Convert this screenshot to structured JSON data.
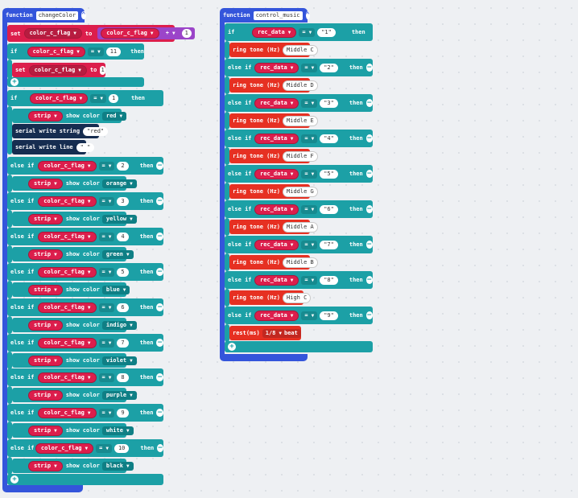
{
  "colors": {
    "function": "#3455db",
    "logic": "#1ca0a6",
    "variable": "#dc1e4c",
    "serial": "#162d50",
    "music": "#e63022",
    "workspace": "#eef0f3"
  },
  "left": {
    "function_kw": "function",
    "function_name": "changeColor",
    "set_kw": "set",
    "var_name": "color_c_flag",
    "to_kw": "to",
    "plus_op": "+",
    "plus_value": "1",
    "if_kw": "if",
    "eq_op": "=",
    "eleven": "11",
    "then_kw": "then",
    "set_value": "1",
    "one": "1",
    "strip": "strip",
    "show_color": "show color",
    "red": "red",
    "serial_write_string": "serial write string",
    "serial_str_val": "\"red\"",
    "serial_write_line": "serial write line",
    "serial_line_val": "\" \"",
    "else_if": "else if",
    "branches": [
      {
        "num": "2",
        "color": "orange"
      },
      {
        "num": "3",
        "color": "yellow"
      },
      {
        "num": "4",
        "color": "green"
      },
      {
        "num": "5",
        "color": "blue"
      },
      {
        "num": "6",
        "color": "indigo"
      },
      {
        "num": "7",
        "color": "violet"
      },
      {
        "num": "8",
        "color": "purple"
      },
      {
        "num": "9",
        "color": "white"
      },
      {
        "num": "10",
        "color": "black"
      }
    ]
  },
  "right": {
    "function_kw": "function",
    "function_name": "control_music",
    "if_kw": "if",
    "else_if": "else if",
    "then_kw": "then",
    "var_name": "rec_data",
    "eq_op": "=",
    "ring_tone": "ring tone (Hz)",
    "branches": [
      {
        "val": "\"1\"",
        "note": "Middle C"
      },
      {
        "val": "\"2\"",
        "note": "Middle D"
      },
      {
        "val": "\"3\"",
        "note": "Middle E"
      },
      {
        "val": "\"4\"",
        "note": "Middle F"
      },
      {
        "val": "\"5\"",
        "note": "Middle G"
      },
      {
        "val": "\"6\"",
        "note": "Middle A"
      },
      {
        "val": "\"7\"",
        "note": "Middle B"
      },
      {
        "val": "\"8\"",
        "note": "High C"
      }
    ],
    "last_val": "\"9\"",
    "rest_label": "rest(ms)",
    "rest_value": "1/8",
    "beat": "beat"
  }
}
